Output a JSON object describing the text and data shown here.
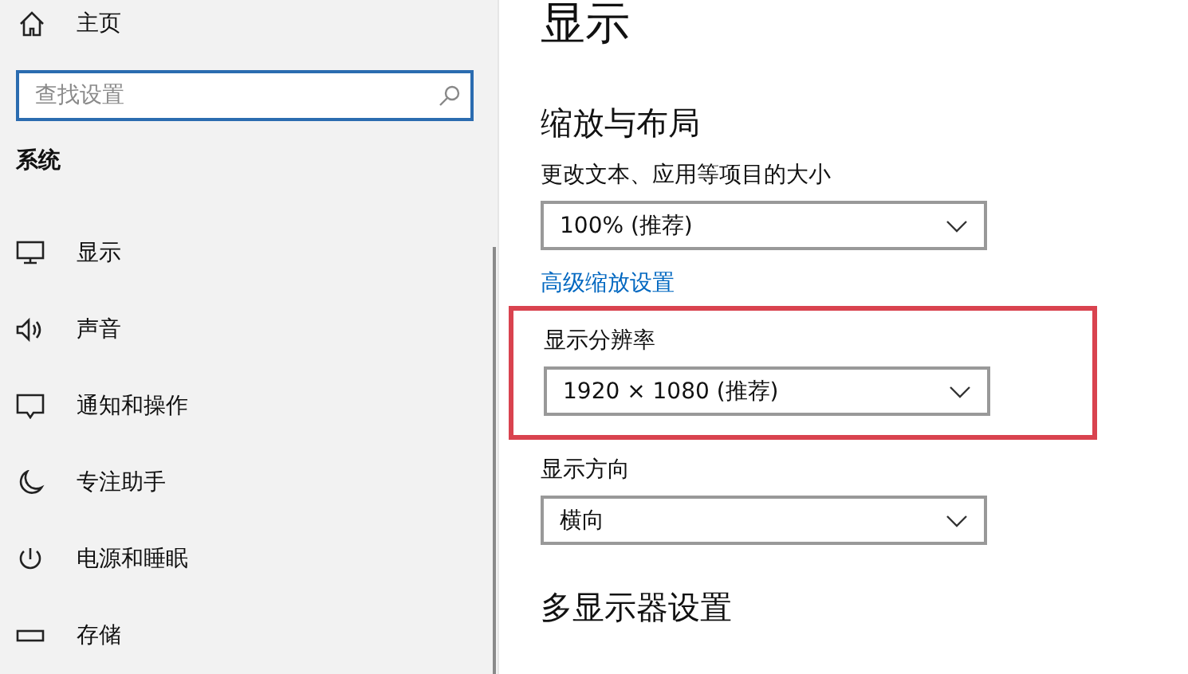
{
  "sidebar": {
    "home": "主页",
    "search": {
      "placeholder": "查找设置"
    },
    "section": "系统",
    "items": [
      {
        "label": "显示",
        "kind": "monitor"
      },
      {
        "label": "声音",
        "kind": "speaker"
      },
      {
        "label": "通知和操作",
        "kind": "message"
      },
      {
        "label": "专注助手",
        "kind": "moon"
      },
      {
        "label": "电源和睡眠",
        "kind": "power"
      },
      {
        "label": "存储",
        "kind": "drive"
      }
    ]
  },
  "main": {
    "title": "显示",
    "section": "缩放与布局",
    "settings": [
      {
        "kind": "dropdown",
        "label": "更改文本、应用等项目的大小",
        "value": "100% (推荐)",
        "highlighted": false
      },
      {
        "kind": "link",
        "label": "高级缩放设置"
      },
      {
        "kind": "dropdown",
        "label": "显示分辨率",
        "value": "1920 × 1080 (推荐)",
        "highlighted": true
      },
      {
        "kind": "dropdown",
        "label": "显示方向",
        "value": "横向",
        "highlighted": false
      }
    ],
    "next_section": "多显示器设置"
  }
}
